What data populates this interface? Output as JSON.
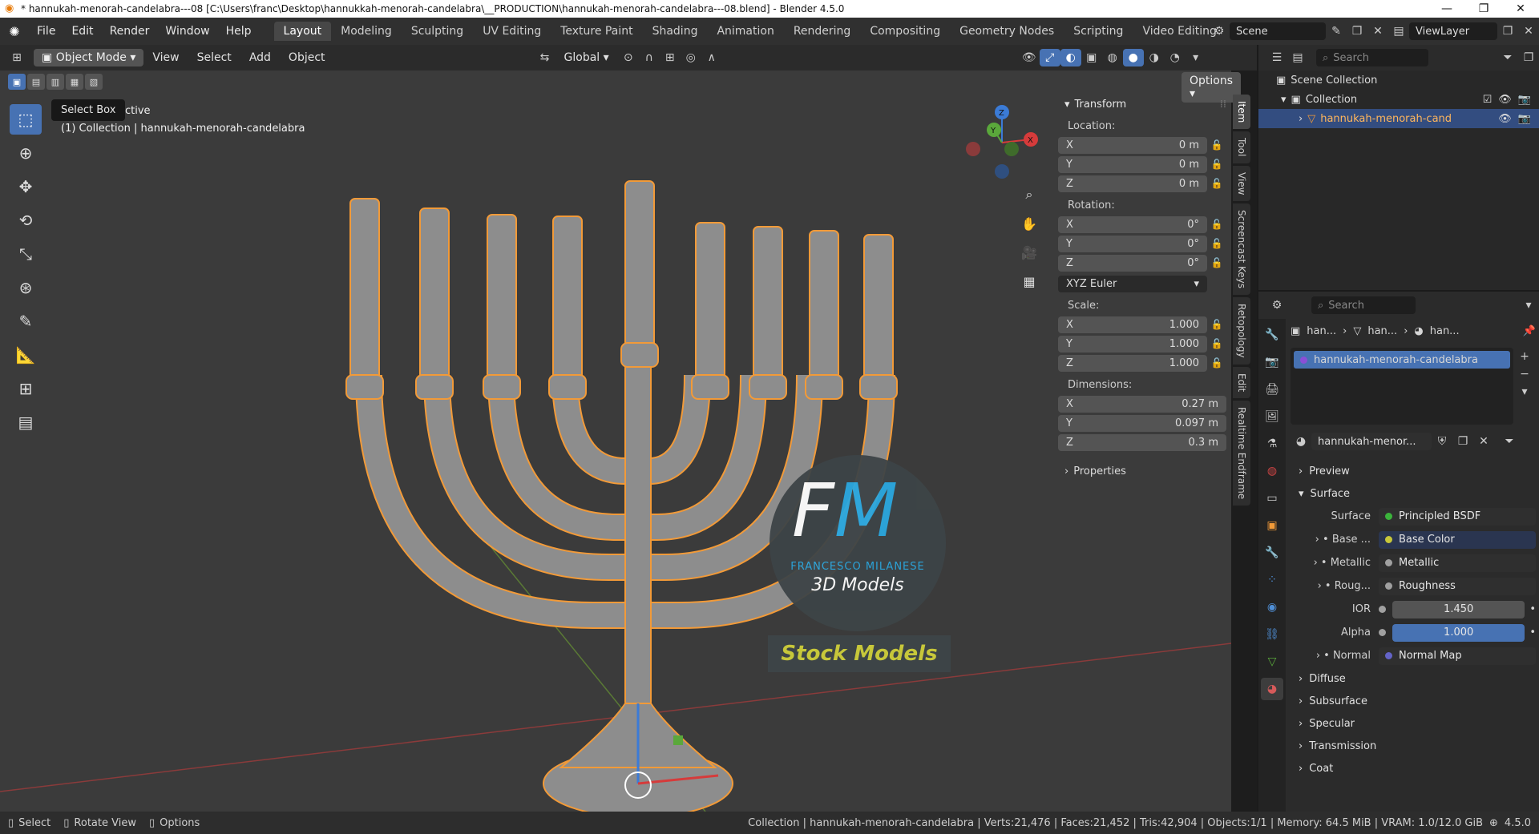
{
  "window": {
    "title": "* hannukah-menorah-candelabra---08 [C:\\Users\\franc\\Desktop\\hannukkah-menorah-candelabra\\__PRODUCTION\\hannukah-menorah-candelabra---08.blend] - Blender 4.5.0",
    "controls": [
      "—",
      "❐",
      "✕"
    ]
  },
  "menubar": {
    "items": [
      "File",
      "Edit",
      "Render",
      "Window",
      "Help"
    ],
    "workspaces": [
      "Layout",
      "Modeling",
      "Sculpting",
      "UV Editing",
      "Texture Paint",
      "Shading",
      "Animation",
      "Rendering",
      "Compositing",
      "Geometry Nodes",
      "Scripting",
      "Video Editing"
    ],
    "active_workspace": "Layout",
    "add_tab": "+",
    "scene": "Scene",
    "view_layer": "ViewLayer"
  },
  "viewport_header": {
    "mode": "Object Mode",
    "menus": [
      "View",
      "Select",
      "Add",
      "Object"
    ],
    "orientation": "Global",
    "options": "Options"
  },
  "viewport": {
    "tooltip": "Select Box",
    "tooltip_tail": "ctive",
    "collection_info": "(1) Collection | hannukah-menorah-candelabra",
    "axes": {
      "x": "X",
      "y": "Y",
      "z": "Z"
    },
    "watermark": {
      "logo_f": "F",
      "logo_m": "M",
      "name": "FRANCESCO MILANESE",
      "subtitle": "3D Models",
      "badge": "Stock Models"
    }
  },
  "npanel": {
    "section": "Transform",
    "location_label": "Location:",
    "location": [
      {
        "axis": "X",
        "value": "0 m"
      },
      {
        "axis": "Y",
        "value": "0 m"
      },
      {
        "axis": "Z",
        "value": "0 m"
      }
    ],
    "rotation_label": "Rotation:",
    "rotation": [
      {
        "axis": "X",
        "value": "0°"
      },
      {
        "axis": "Y",
        "value": "0°"
      },
      {
        "axis": "Z",
        "value": "0°"
      }
    ],
    "rotation_mode": "XYZ Euler",
    "scale_label": "Scale:",
    "scale": [
      {
        "axis": "X",
        "value": "1.000"
      },
      {
        "axis": "Y",
        "value": "1.000"
      },
      {
        "axis": "Z",
        "value": "1.000"
      }
    ],
    "dimensions_label": "Dimensions:",
    "dimensions": [
      {
        "axis": "X",
        "value": "0.27 m"
      },
      {
        "axis": "Y",
        "value": "0.097 m"
      },
      {
        "axis": "Z",
        "value": "0.3 m"
      }
    ],
    "properties": "Properties",
    "tabs": [
      "Item",
      "Tool",
      "View",
      "Screencast Keys",
      "Retopology",
      "Edit",
      "Realtime Endframe"
    ]
  },
  "outliner": {
    "search_placeholder": "Search",
    "scene_collection": "Scene Collection",
    "collection": "Collection",
    "object": "hannukah-menorah-cand"
  },
  "properties": {
    "search_placeholder": "Search",
    "breadcrumb": [
      "han...",
      "han...",
      "han..."
    ],
    "material_slot": "hannukah-menorah-candelabra",
    "material_name": "hannukah-menor...",
    "preview": "Preview",
    "surface_section": "Surface",
    "surface_label": "Surface",
    "surface_value": "Principled BSDF",
    "inputs": [
      {
        "label": "Base ...",
        "value": "Base Color",
        "color": "#c7c73a",
        "expand": true
      },
      {
        "label": "Metallic",
        "value": "Metallic",
        "color": "#a0a0a0",
        "expand": true
      },
      {
        "label": "Roug...",
        "value": "Roughness",
        "color": "#a0a0a0",
        "expand": true
      },
      {
        "label": "IOR",
        "value": "1.450",
        "color": "#a0a0a0",
        "expand": false
      },
      {
        "label": "Alpha",
        "value": "1.000",
        "color": "#a0a0a0",
        "expand": false
      },
      {
        "label": "Normal",
        "value": "Normal Map",
        "color": "#6363c7",
        "expand": true
      }
    ],
    "subsections": [
      "Diffuse",
      "Subsurface",
      "Specular",
      "Transmission",
      "Coat"
    ]
  },
  "statusbar": {
    "left": [
      {
        "key": "Select"
      },
      {
        "key": "Rotate View"
      },
      {
        "key": "Options"
      }
    ],
    "stats": "Collection | hannukah-menorah-candelabra | Verts:21,476 | Faces:21,452 | Tris:42,904 | Objects:1/1 | Memory: 64.5 MiB | VRAM: 1.0/12.0 GiB",
    "version": "4.5.0"
  }
}
